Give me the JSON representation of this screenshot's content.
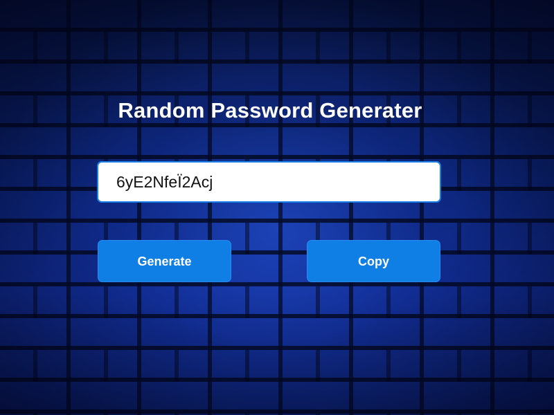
{
  "title": "Random Password Generater",
  "password_field": {
    "value": "6yE2NfeÏ2Acj"
  },
  "buttons": {
    "generate_label": "Generate",
    "copy_label": "Copy"
  },
  "colors": {
    "button_bg": "#0f7fe6",
    "field_border": "#1b7fe8",
    "background": "#0b2270",
    "title_text": "#ffffff"
  }
}
